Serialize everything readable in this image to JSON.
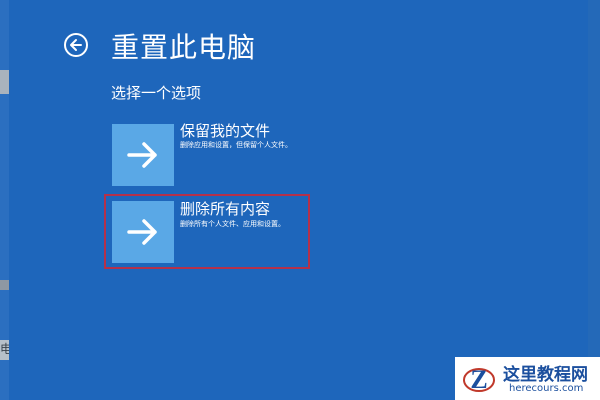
{
  "header": {
    "back_icon": "back-arrow-icon",
    "title": "重置此电脑"
  },
  "subtitle": "选择一个选项",
  "options": [
    {
      "icon": "arrow-right-icon",
      "title": "保留我的文件",
      "description": "删除应用和设置，但保留个人文件。"
    },
    {
      "icon": "arrow-right-icon",
      "title": "删除所有内容",
      "description": "删除所有个人文件、应用和设置。",
      "highlighted": true
    }
  ],
  "background_edge_text": "电",
  "watermark": {
    "name": "这里教程网",
    "url": "herecours.com",
    "logo_letter": "Z"
  },
  "colors": {
    "background": "#1e66bb",
    "tile": "#5aa8e6",
    "text": "#ffffff",
    "highlight_border": "#b5314a",
    "watermark_text": "#1b4f9e"
  }
}
